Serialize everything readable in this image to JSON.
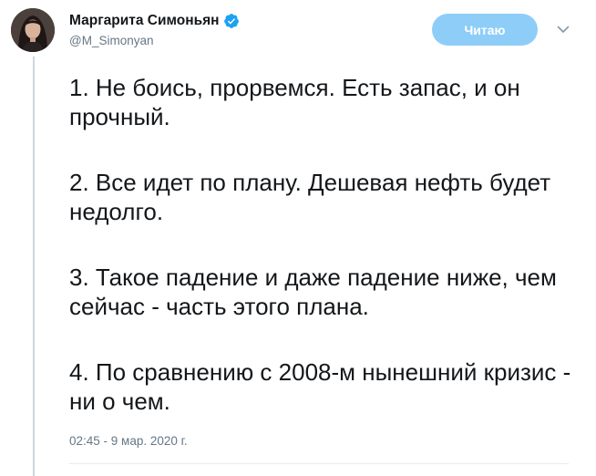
{
  "author": {
    "display_name": "Маргарита Симоньян",
    "username": "@M_Simonyan",
    "verified": true,
    "avatar_icon": "profile-photo"
  },
  "actions": {
    "follow_label": "Читаю",
    "menu_icon": "chevron-down-icon"
  },
  "tweet": {
    "paragraphs": [
      "1. Не боись, прорвемся. Есть запас, и он прочный.",
      "2. Все идет по плану. Дешевая нефть будет недолго.",
      "3. Такое падение и даже падение ниже, чем сейчас - часть этого плана.",
      "4. По сравнению с 2008-м нынешний кризис - ни о чем."
    ],
    "timestamp": "02:45 - 9 мар. 2020 г."
  },
  "colors": {
    "accent": "#1da1f2",
    "follow_button_bg": "#8ecdf8",
    "secondary_text": "#657786",
    "thread_line": "#ccd6dd"
  }
}
